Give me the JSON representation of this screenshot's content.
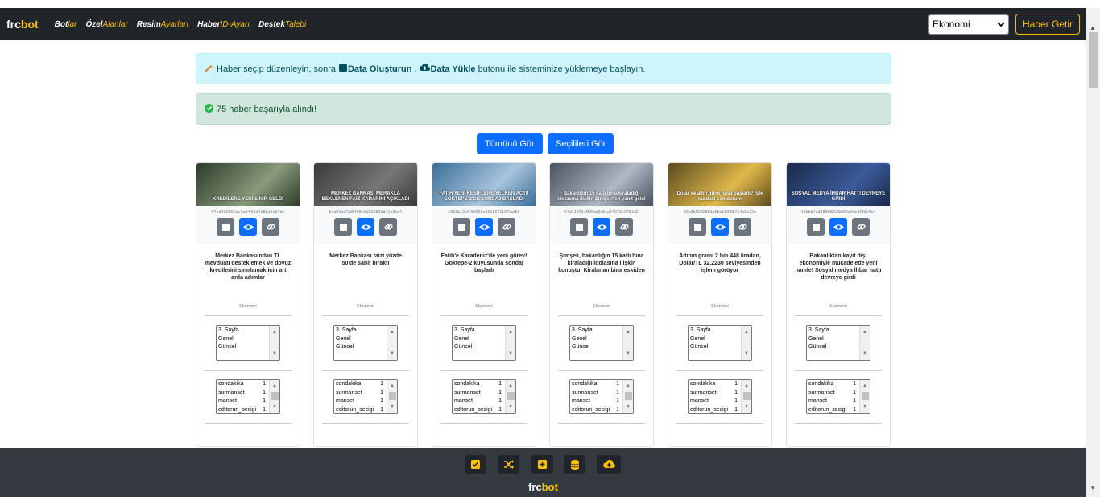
{
  "navbar": {
    "brand_a": "frc",
    "brand_b": "bot",
    "links": [
      {
        "a": "Bot",
        "b": "lar"
      },
      {
        "a": "Özel",
        "b": "Alanlar"
      },
      {
        "a": "Resim",
        "b": "Ayarları"
      },
      {
        "a": "Haber",
        "b": "ID-Ayarı"
      },
      {
        "a": "Destek",
        "b": "Talebi"
      }
    ],
    "category_select": "Ekonomi",
    "fetch_button": "Haber Getir"
  },
  "alerts": {
    "info_prefix": "Haber seçip düzenleyin, sonra",
    "info_create": "Data Oluşturun",
    "info_upload": "Data Yükle",
    "info_suffix": "butonu ile sisteminize yüklemeye başlayın.",
    "success": "75 haber başarıyla alındı!"
  },
  "buttons": {
    "view_all": "Tümünü Gör",
    "view_selected": "Seçilileri Gör"
  },
  "cards": [
    {
      "hash": "ff7ed420652ae7ad4f68a4d8ba4e67de",
      "image_caption": "KREDİLERE YENİ SINIR GELDİ",
      "image_colors": [
        "#2d3b2a",
        "#8a9a7a"
      ],
      "title": "Merkez Bankası'ndan TL mevduatı desteklemek ve dövüz kredilerini sınırlamak için art arda adımlar",
      "category": "Ekonomi",
      "pages": [
        "3. Sayfa",
        "Genel",
        "Güncel"
      ],
      "tags": [
        {
          "n": "sondakika",
          "c": "1"
        },
        {
          "n": "surmanset",
          "c": "1"
        },
        {
          "n": "manset",
          "c": "1"
        },
        {
          "n": "editorun_secigi",
          "c": "1"
        }
      ]
    },
    {
      "hash": "b1d3cfa72d6488e6d20082dd41e2cd4",
      "image_caption": "MERKEZ BANKASI MERAKLA BEKLENEN FAİZ KARARINI AÇIKLADI",
      "image_colors": [
        "#3a3a3a",
        "#777777"
      ],
      "title": "Merkez Bankası faizi yüzde 50'de sabit bıraktı",
      "category": "Ekonomi",
      "pages": [
        "3. Sayfa",
        "Genel",
        "Güncel"
      ],
      "tags": [
        {
          "n": "sondakika",
          "c": "1"
        },
        {
          "n": "surmanset",
          "c": "1"
        },
        {
          "n": "manset",
          "c": "1"
        },
        {
          "n": "editorun_secigi",
          "c": "1"
        }
      ]
    },
    {
      "hash": "1681b12e64bf06be5918671127daf56",
      "image_caption": "FATİH YENİ KEŞİFLERE YELKEN AÇTI! GÖKTEPE-2'DE SONDAJ BAŞLADI",
      "image_colors": [
        "#3a6f9a",
        "#a8c4dc"
      ],
      "title": "Fatih'e Karadeniz'de yeni görev! Göktepe-2 kuyusunda sondaj başladı",
      "category": "Ekonomi",
      "pages": [
        "3. Sayfa",
        "Genel",
        "Güncel"
      ],
      "tags": [
        {
          "n": "sondakika",
          "c": "1"
        },
        {
          "n": "surmanset",
          "c": "1"
        },
        {
          "n": "manset",
          "c": "1"
        },
        {
          "n": "editorun_secigi",
          "c": "1"
        }
      ]
    },
    {
      "hash": "64d11270ef589af3c5ca44072e0751d2",
      "image_caption": "Bakanlığın 15 katlı bina kiraladığı iddiasına ilişkin Şimşek'ten yanıt geldi",
      "image_colors": [
        "#4a5160",
        "#b0b8c4"
      ],
      "title": "Şimşek, bakanlığın 15 katlı bina kiraladığı iddiasına ilişkin konuştu: Kiralanan bina eskiden",
      "category": "Ekonomi",
      "pages": [
        "3. Sayfa",
        "Genel",
        "Güncel"
      ],
      "tags": [
        {
          "n": "sondakika",
          "c": "1"
        },
        {
          "n": "surmanset",
          "c": "1"
        },
        {
          "n": "manset",
          "c": "1"
        },
        {
          "n": "editorun_secigi",
          "c": "1"
        }
      ]
    },
    {
      "hash": "82b3bf925f883a55c1809f87e4c5c22a",
      "image_caption": "Dolar ve altın güne nasıl başladı? İşte kurdaki son durum",
      "image_colors": [
        "#5a4a20",
        "#e0b84a"
      ],
      "title": "Altının gramı 2 bin 448 liradan, Dolar/TL 32,2230 seviyesinden işlem görüyor",
      "category": "Ekonomi",
      "pages": [
        "3. Sayfa",
        "Genel",
        "Güncel"
      ],
      "tags": [
        {
          "n": "sondakika",
          "c": "1"
        },
        {
          "n": "surmanset",
          "c": "1"
        },
        {
          "n": "manset",
          "c": "1"
        },
        {
          "n": "editorun_secigi",
          "c": "1"
        }
      ]
    },
    {
      "hash": "16bbb7ed688fd9628d90e2de30f3e6b4",
      "image_caption": "SOSYAL MEDYA İHBAR HATTI DEVREYE GİRDİ",
      "image_colors": [
        "#1a2a4a",
        "#3b5b9a"
      ],
      "title": "Bakanlıktan kayıt dışı ekonomiyle mücadelede yeni hamle! Sosyal medya İhbar hattı devreye girdi",
      "category": "Ekonomi",
      "pages": [
        "3. Sayfa",
        "Genel",
        "Güncel"
      ],
      "tags": [
        {
          "n": "sondakika",
          "c": "1"
        },
        {
          "n": "surmanset",
          "c": "1"
        },
        {
          "n": "manset",
          "c": "1"
        },
        {
          "n": "editorun_secigi",
          "c": "1"
        }
      ]
    }
  ],
  "footer": {
    "brand_a": "frc",
    "brand_b": "bot",
    "actions": [
      "check-square-icon",
      "shuffle-icon",
      "plus-square-icon",
      "database-icon",
      "cloud-upload-icon"
    ]
  }
}
